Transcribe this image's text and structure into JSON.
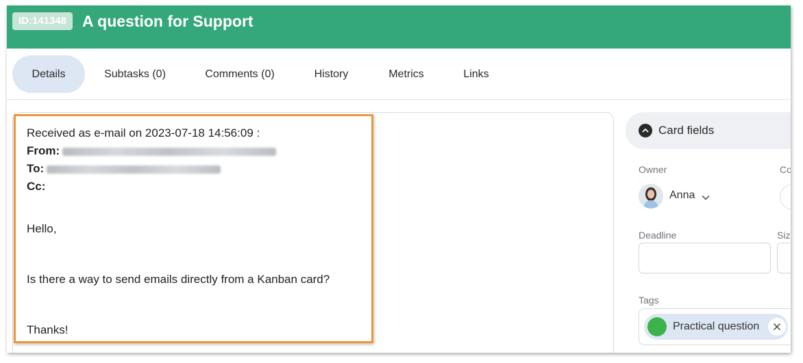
{
  "header": {
    "id_badge": "ID:141348",
    "title": "A question for Support",
    "color": "#34a77b"
  },
  "tabs": [
    {
      "label": "Details",
      "active": true
    },
    {
      "label": "Subtasks (0)",
      "active": false
    },
    {
      "label": "Comments (0)",
      "active": false
    },
    {
      "label": "History",
      "active": false
    },
    {
      "label": "Metrics",
      "active": false
    },
    {
      "label": "Links",
      "active": false
    }
  ],
  "email": {
    "received_line": "Received as e-mail on 2023-07-18 14:56:09 :",
    "from_label": "From:",
    "to_label": "To:",
    "cc_label": "Cc:",
    "greeting": "Hello,",
    "body": "Is there a way to send emails directly from a Kanban card?",
    "closing": "Thanks!",
    "highlight_color": "#f0953a"
  },
  "card_fields": {
    "header_label": "Card fields",
    "owner_label": "Owner",
    "owner_name": "Anna",
    "co_label": "Co",
    "deadline_label": "Deadline",
    "size_label": "Size",
    "tags_label": "Tags",
    "tags": [
      {
        "label": "Practical question",
        "color": "#3cb34a"
      }
    ]
  },
  "icons": {
    "collapse": "chevron-up-circle-icon",
    "owner_dropdown": "chevron-down-icon",
    "tag_remove": "close-icon"
  }
}
